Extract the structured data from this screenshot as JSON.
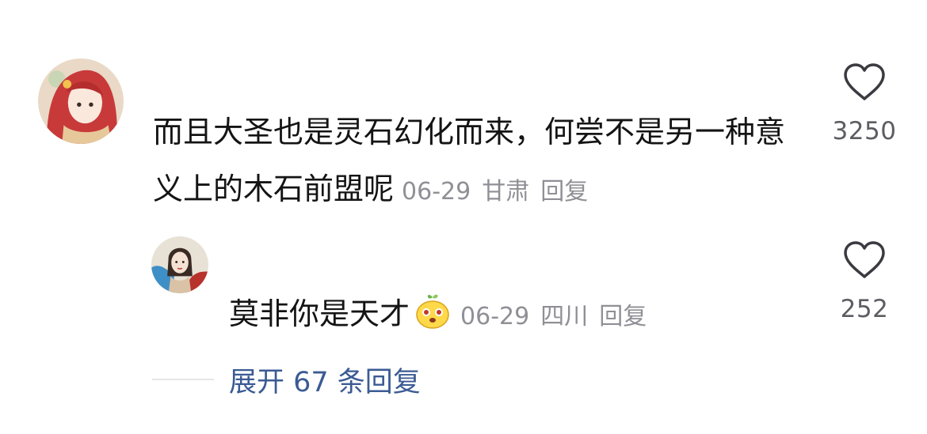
{
  "comments": [
    {
      "avatar_icon": "anime-red-hair-avatar",
      "text": "而且大圣也是灵石幻化而来，何尝不是另一种意义上的木石前盟呢",
      "date": "06-29",
      "location": "甘肃",
      "reply_label": "回复",
      "likes": "3250"
    },
    {
      "avatar_icon": "painted-lady-avatar",
      "text": "莫非你是天才",
      "emoji_icon": "yellow-face-emoji",
      "date": "06-29",
      "location": "四川",
      "reply_label": "回复",
      "likes": "252"
    }
  ],
  "expand_replies_label": "展开 67 条回复",
  "colors": {
    "text": "#141414",
    "meta": "#8f8f96",
    "link": "#3b5b93",
    "like_count": "#5c5c63"
  }
}
